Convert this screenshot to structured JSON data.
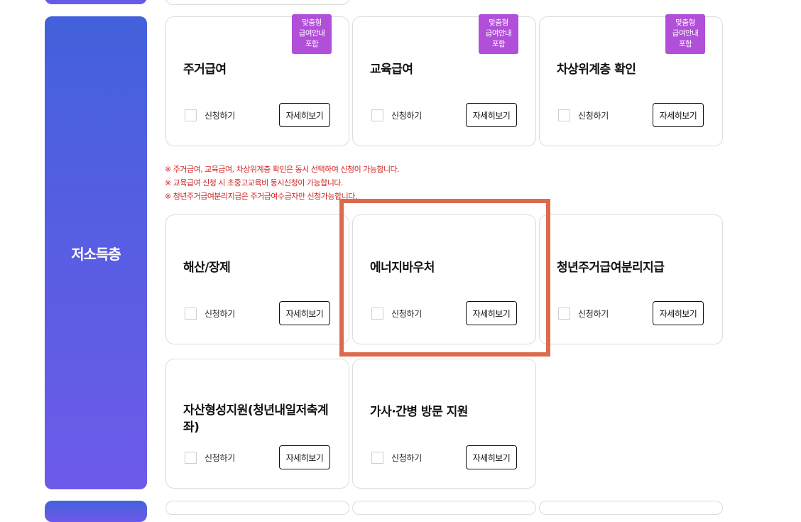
{
  "category": {
    "label": "저소득층"
  },
  "common": {
    "apply_label": "신청하기",
    "detail_label": "자세히보기"
  },
  "badge": {
    "line1": "맞춤형",
    "line2": "급여안내",
    "line3": "포함",
    "color": "#b14fd8"
  },
  "cards": [
    {
      "title": "주거급여",
      "badge": true
    },
    {
      "title": "교육급여",
      "badge": true
    },
    {
      "title": "차상위계층 확인",
      "badge": true
    },
    {
      "title": "해산/장제",
      "badge": false
    },
    {
      "title": "에너지바우처",
      "badge": false,
      "highlighted": true
    },
    {
      "title": "청년주거급여분리지급",
      "badge": false
    },
    {
      "title": "자산형성지원(청년내일저축계좌)",
      "badge": false
    },
    {
      "title": "가사·간병 방문 지원",
      "badge": false
    }
  ],
  "notes": [
    "※ 주거급여, 교육급여, 차상위계층 확인은 동시 선택하여 신청이 가능합니다.",
    "※ 교육급여 신청 시 초중고교육비 동시신청이 가능합니다.",
    "※ 청년주거급여분리지급은 주거급여수급자만 신청가능합니다."
  ],
  "colors": {
    "sidebar_top": "#4361dc",
    "sidebar_bottom": "#6d5aea",
    "notes": "#d22424",
    "highlight": "#dc6a4c"
  }
}
